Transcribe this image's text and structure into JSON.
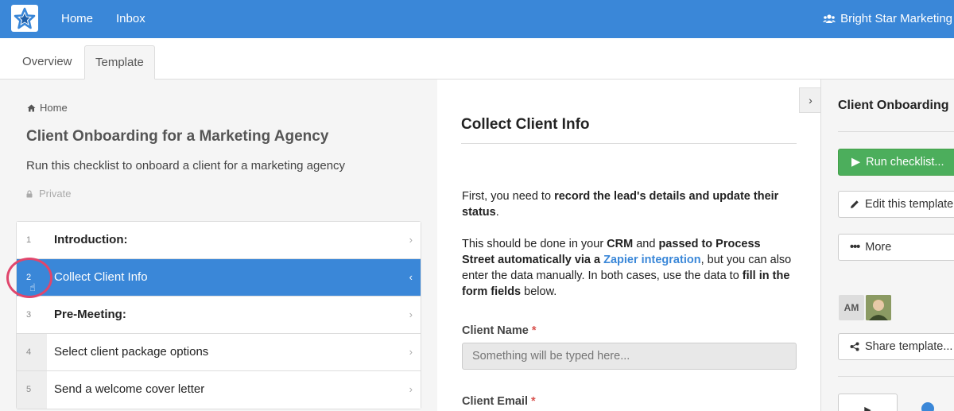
{
  "topbar": {
    "nav": [
      "Home",
      "Inbox"
    ],
    "org_name": "Bright Star Marketing",
    "colors": {
      "primary": "#3a87d8",
      "success": "#4cae5c"
    }
  },
  "tabs": [
    "Overview",
    "Template"
  ],
  "template": {
    "breadcrumb": "Home",
    "title": "Client Onboarding for a Marketing Agency",
    "description": "Run this checklist to onboard a client for a marketing agency",
    "visibility": "Private"
  },
  "tasks": [
    {
      "num": "1",
      "label": "Introduction:",
      "heading": true,
      "active": false
    },
    {
      "num": "2",
      "label": "Collect Client Info",
      "heading": false,
      "active": true
    },
    {
      "num": "3",
      "label": "Pre-Meeting:",
      "heading": true,
      "active": false
    },
    {
      "num": "4",
      "label": "Select client package options",
      "heading": false,
      "active": false
    },
    {
      "num": "5",
      "label": "Send a welcome cover letter",
      "heading": false,
      "active": false
    }
  ],
  "task_detail": {
    "title": "Collect Client Info",
    "para1": {
      "t1": "First, you need to ",
      "b1": "record the lead's details and update their status",
      "t2": "."
    },
    "para2": {
      "t1": "This should be done in your ",
      "b1": "CRM",
      "t2": " and ",
      "b2": "passed to Process Street automatically via a ",
      "link": "Zapier integration",
      "t3": ", but you can also enter the data manually. In both cases, use the data to ",
      "b3": "fill in the form fields",
      "t4": " below."
    },
    "fields": [
      {
        "label": "Client Name",
        "required": "*",
        "placeholder": "Something will be typed here..."
      },
      {
        "label": "Client Email",
        "required": "*"
      }
    ]
  },
  "sidebar": {
    "title": "Client Onboarding",
    "run_button": "Run checklist...",
    "edit_button": "Edit this template",
    "more_button": "More",
    "avatar_initials": "AM",
    "share_button": "Share template..."
  }
}
